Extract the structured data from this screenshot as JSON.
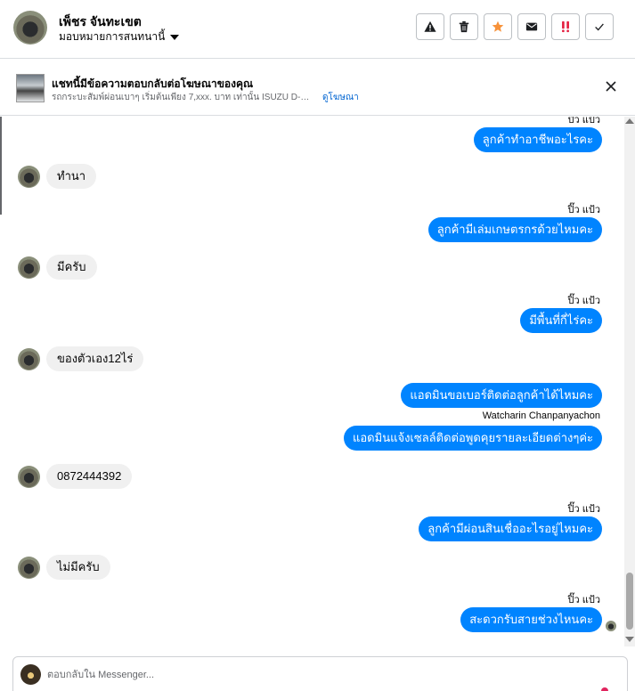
{
  "header": {
    "contact_name": "เพ็ชร จันทะเขต",
    "assign_label": "มอบหมายการสนทนานี้",
    "actions": [
      {
        "name": "report-button",
        "icon": "warning-icon"
      },
      {
        "name": "delete-button",
        "icon": "trash-icon"
      },
      {
        "name": "star-button",
        "icon": "star-icon"
      },
      {
        "name": "mark-unread-button",
        "icon": "envelope-icon"
      },
      {
        "name": "mark-spam-button",
        "icon": "exclamation-icon"
      },
      {
        "name": "done-button",
        "icon": "checkmark-icon"
      }
    ],
    "colors": {
      "star": "#f7923a",
      "spam": "#e41e3f"
    }
  },
  "ad": {
    "title": "แชทนี้มีข้อความตอบกลับต่อโฆษณาของคุณ",
    "subtitle": "รถกระบะสัมพ์ผ่อนเบาๆ เริ่มต้นเพียง 7,xxx. บาท เท่านั้น ISUZU D-MAX A...",
    "link": "ดูโฆษณา"
  },
  "messages": {
    "top_seen": "ปิ๊ว แป้ว",
    "out_1": "ลูกค้าทำอาชีพอะไรคะ",
    "in_1": "ทำนา",
    "label_2": "ปิ๊ว แป้ว",
    "out_2": "ลูกค้ามีเล่มเกษตรกรด้วยไหมคะ",
    "in_2": "มีครับ",
    "label_3": "ปิ๊ว แป้ว",
    "out_3": "มีพื้นที่กี่ไร่คะ",
    "in_3": "ของตัวเอง12ไร่",
    "out_4": "แอดมินขอเบอร์ติดต่อลูกค้าได้ไหมคะ",
    "label_4": "Watcharin Chanpanyachon",
    "out_5": "แอดมินแจ้งเซลล์ติดต่อพูดคุยรายละเอียดต่างๆค่ะ",
    "in_4": "0872444392",
    "label_5": "ปิ๊ว แป้ว",
    "out_6": "ลูกค้ามีผ่อนสินเชื่ออะไรอยู่ไหมคะ",
    "in_5": "ไม่มีครับ",
    "label_6": "ปิ๊ว แป้ว",
    "out_7": "สะดวกรับสายช่วงไหนคะ"
  },
  "composer": {
    "placeholder": "ตอบกลับใน Messenger..."
  },
  "colors": {
    "outgoing_bubble": "#0084ff",
    "incoming_bubble": "#f0f0f0",
    "link": "#0064d1"
  }
}
